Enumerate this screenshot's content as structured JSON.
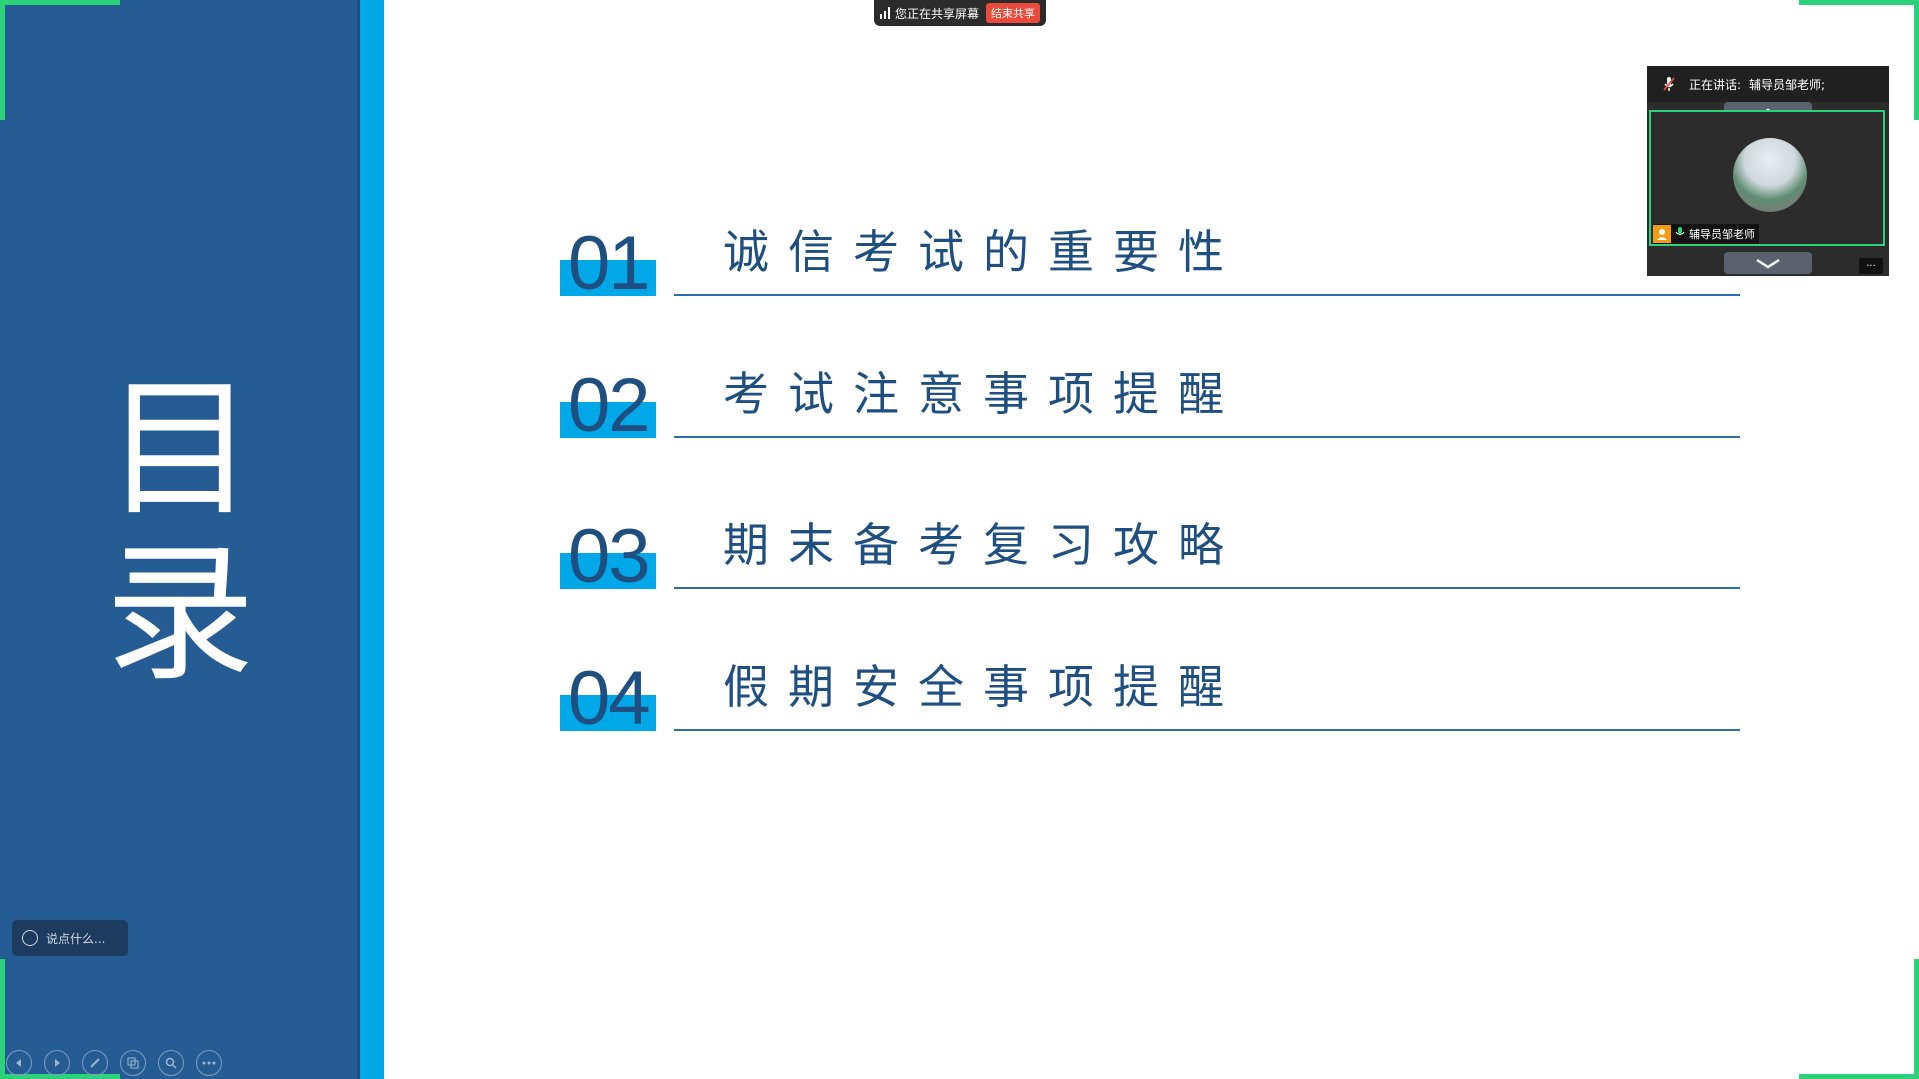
{
  "slide": {
    "title_chars": [
      "目",
      "录"
    ],
    "items": [
      {
        "number": "01",
        "text": "诚信考试的重要性"
      },
      {
        "number": "02",
        "text": "考试注意事项提醒"
      },
      {
        "number": "03",
        "text": "期末备考复习攻略"
      },
      {
        "number": "04",
        "text": "假期安全事项提醒"
      }
    ],
    "colors": {
      "panel": "#245c93",
      "accent": "#00a8e8",
      "text": "#1f4f80"
    }
  },
  "share_bar": {
    "status": "您正在共享屏幕",
    "stop_label": "结束共享",
    "icon": "signal-bars-icon"
  },
  "video_panel": {
    "speaking_label": "正在讲话:",
    "speaker": "辅导员邹老师;",
    "tile_name": "辅导员邹老师",
    "more_label": "...",
    "up_icon": "chevron-up-icon",
    "down_icon": "chevron-down-icon"
  },
  "chat": {
    "placeholder": "说点什么..."
  },
  "toolbar": {
    "items": [
      {
        "name": "previous-icon"
      },
      {
        "name": "next-icon"
      },
      {
        "name": "pen-icon"
      },
      {
        "name": "slides-icon"
      },
      {
        "name": "zoom-icon"
      },
      {
        "name": "more-icon"
      }
    ]
  }
}
